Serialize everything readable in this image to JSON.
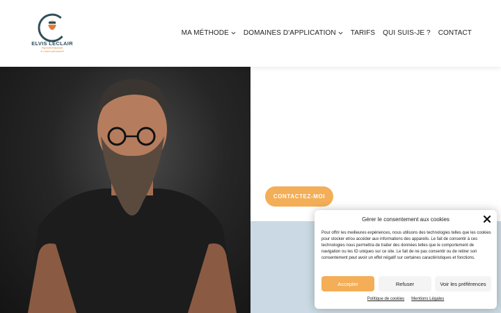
{
  "header": {
    "logo": {
      "name": "ELVIS LECLAIR",
      "subtitle": "Hypnothérapeute",
      "tagline": "& coach personnel"
    },
    "nav": [
      {
        "label": "MA MÉTHODE",
        "has_dropdown": true
      },
      {
        "label": "DOMAINES D'APPLICATION",
        "has_dropdown": true
      },
      {
        "label": "TARIFS",
        "has_dropdown": false
      },
      {
        "label": "QUI SUIS-JE ?",
        "has_dropdown": false
      },
      {
        "label": "CONTACT",
        "has_dropdown": false
      }
    ]
  },
  "hero": {
    "cta_label": "CONTACTEZ-MOI"
  },
  "consent": {
    "title": "Gérer le consentement aux cookies",
    "body": "Pour offrir les meilleures expériences, nous utilisons des technologies telles que les cookies pour stocker et/ou accéder aux informations des appareils. Le fait de consentir à ces technologies nous permettra de traiter des données telles que le comportement de navigation ou les ID uniques sur ce site. Le fait de ne pas consentir ou de retirer son consentement peut avoir un effet négatif sur certaines caractéristiques et fonctions.",
    "accept_label": "Accepter",
    "refuse_label": "Refuser",
    "prefs_label": "Voir les préférences",
    "links": [
      "Politique de cookies",
      "Mentions Légales"
    ]
  },
  "colors": {
    "accent": "#f3ae57",
    "brand_dark": "#2f4e5b",
    "section_blue": "#cad9e3"
  }
}
